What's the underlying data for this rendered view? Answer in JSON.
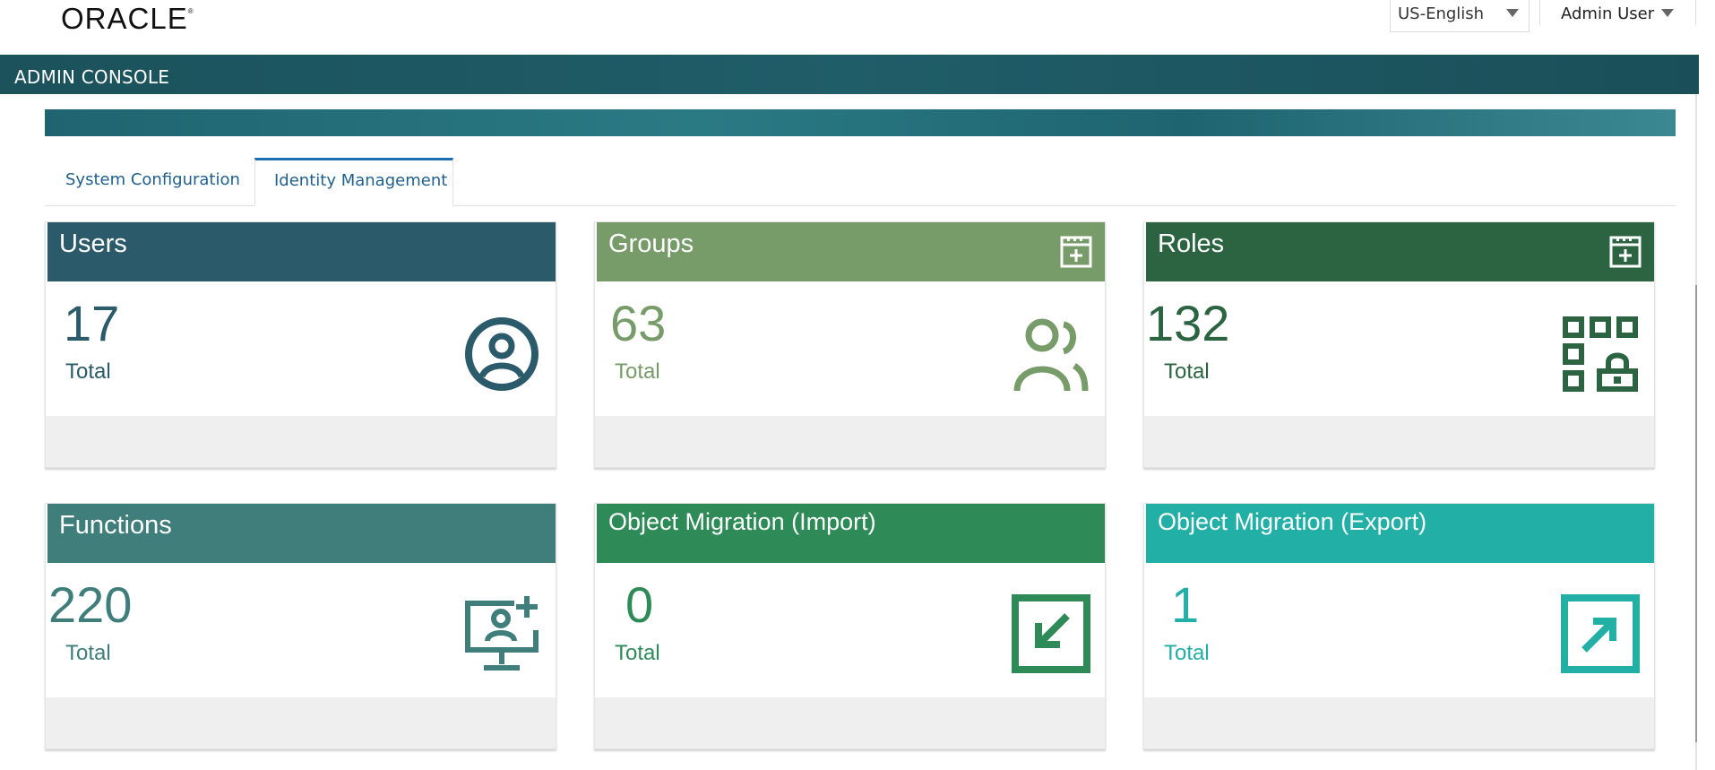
{
  "header": {
    "logo": "ORACLE",
    "logo_mark": "®",
    "language": "US-English",
    "user": "Admin User",
    "console_title": "ADMIN CONSOLE"
  },
  "tabs": [
    {
      "label": "System Configuration",
      "active": false
    },
    {
      "label": "Identity Management",
      "active": true
    }
  ],
  "cards": [
    {
      "title": "Users",
      "count": "17",
      "total_label": "Total",
      "color": "#2b5a6a",
      "icon": "user-circle-icon",
      "has_add": false
    },
    {
      "title": "Groups",
      "count": "63",
      "total_label": "Total",
      "color": "#789b6a",
      "icon": "people-icon",
      "has_add": true
    },
    {
      "title": "Roles",
      "count": "132",
      "total_label": "Total",
      "color": "#2c6442",
      "icon": "role-grid-lock-icon",
      "has_add": true
    },
    {
      "title": "Functions",
      "count": "220",
      "total_label": "Total",
      "color": "#3f7e7b",
      "icon": "monitor-user-add-icon",
      "has_add": false
    },
    {
      "title": "Object Migration (Import)",
      "count": "0",
      "total_label": "Total",
      "color": "#2e8b57",
      "icon": "import-arrow-icon",
      "has_add": false
    },
    {
      "title": "Object Migration (Export)",
      "count": "1",
      "total_label": "Total",
      "color": "#22afa6",
      "icon": "export-arrow-icon",
      "has_add": false
    }
  ]
}
